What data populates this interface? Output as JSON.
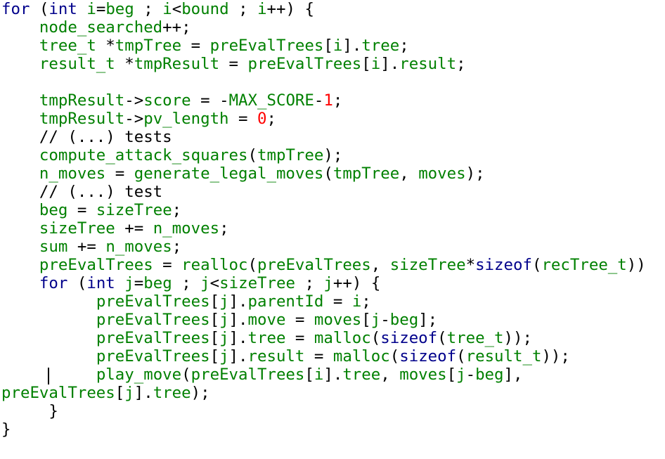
{
  "editor": {
    "colors": {
      "keyword": "#00008b",
      "identifier": "#008000",
      "number": "#ff0000",
      "punctuation": "#000000",
      "background": "#ffffff"
    },
    "lines": [
      [
        [
          "kw",
          "for"
        ],
        [
          "sp",
          " "
        ],
        [
          "pun",
          "("
        ],
        [
          "kw",
          "int"
        ],
        [
          "sp",
          " "
        ],
        [
          "id",
          "i"
        ],
        [
          "pun",
          "="
        ],
        [
          "id",
          "beg"
        ],
        [
          "sp",
          " "
        ],
        [
          "pun",
          ";"
        ],
        [
          "sp",
          " "
        ],
        [
          "id",
          "i"
        ],
        [
          "pun",
          "<"
        ],
        [
          "id",
          "bound"
        ],
        [
          "sp",
          " "
        ],
        [
          "pun",
          ";"
        ],
        [
          "sp",
          " "
        ],
        [
          "id",
          "i"
        ],
        [
          "pun",
          "++) {"
        ]
      ],
      [
        [
          "sp",
          "    "
        ],
        [
          "id",
          "node_searched"
        ],
        [
          "pun",
          "++;"
        ]
      ],
      [
        [
          "sp",
          "    "
        ],
        [
          "id",
          "tree_t"
        ],
        [
          "sp",
          " "
        ],
        [
          "pun",
          "*"
        ],
        [
          "id",
          "tmpTree"
        ],
        [
          "sp",
          " "
        ],
        [
          "pun",
          "="
        ],
        [
          "sp",
          " "
        ],
        [
          "id",
          "preEvalTrees"
        ],
        [
          "pun",
          "["
        ],
        [
          "id",
          "i"
        ],
        [
          "pun",
          "]."
        ],
        [
          "id",
          "tree"
        ],
        [
          "pun",
          ";"
        ]
      ],
      [
        [
          "sp",
          "    "
        ],
        [
          "id",
          "result_t"
        ],
        [
          "sp",
          " "
        ],
        [
          "pun",
          "*"
        ],
        [
          "id",
          "tmpResult"
        ],
        [
          "sp",
          " "
        ],
        [
          "pun",
          "="
        ],
        [
          "sp",
          " "
        ],
        [
          "id",
          "preEvalTrees"
        ],
        [
          "pun",
          "["
        ],
        [
          "id",
          "i"
        ],
        [
          "pun",
          "]."
        ],
        [
          "id",
          "result"
        ],
        [
          "pun",
          ";"
        ]
      ],
      [],
      [
        [
          "sp",
          "    "
        ],
        [
          "id",
          "tmpResult"
        ],
        [
          "pun",
          "->"
        ],
        [
          "id",
          "score"
        ],
        [
          "sp",
          " "
        ],
        [
          "pun",
          "="
        ],
        [
          "sp",
          " "
        ],
        [
          "pun",
          "-"
        ],
        [
          "id",
          "MAX_SCORE"
        ],
        [
          "pun",
          "-"
        ],
        [
          "num",
          "1"
        ],
        [
          "pun",
          ";"
        ]
      ],
      [
        [
          "sp",
          "    "
        ],
        [
          "id",
          "tmpResult"
        ],
        [
          "pun",
          "->"
        ],
        [
          "id",
          "pv_length"
        ],
        [
          "sp",
          " "
        ],
        [
          "pun",
          "="
        ],
        [
          "sp",
          " "
        ],
        [
          "num",
          "0"
        ],
        [
          "pun",
          ";"
        ]
      ],
      [
        [
          "sp",
          "    "
        ],
        [
          "cmt",
          "// (...) tests"
        ]
      ],
      [
        [
          "sp",
          "    "
        ],
        [
          "id",
          "compute_attack_squares"
        ],
        [
          "pun",
          "("
        ],
        [
          "id",
          "tmpTree"
        ],
        [
          "pun",
          ");"
        ]
      ],
      [
        [
          "sp",
          "    "
        ],
        [
          "id",
          "n_moves"
        ],
        [
          "sp",
          " "
        ],
        [
          "pun",
          "="
        ],
        [
          "sp",
          " "
        ],
        [
          "id",
          "generate_legal_moves"
        ],
        [
          "pun",
          "("
        ],
        [
          "id",
          "tmpTree"
        ],
        [
          "pun",
          ","
        ],
        [
          "sp",
          " "
        ],
        [
          "id",
          "moves"
        ],
        [
          "pun",
          ");"
        ]
      ],
      [
        [
          "sp",
          "    "
        ],
        [
          "cmt",
          "// (...) test"
        ]
      ],
      [
        [
          "sp",
          "    "
        ],
        [
          "id",
          "beg"
        ],
        [
          "sp",
          " "
        ],
        [
          "pun",
          "="
        ],
        [
          "sp",
          " "
        ],
        [
          "id",
          "sizeTree"
        ],
        [
          "pun",
          ";"
        ]
      ],
      [
        [
          "sp",
          "    "
        ],
        [
          "id",
          "sizeTree"
        ],
        [
          "sp",
          " "
        ],
        [
          "pun",
          "+="
        ],
        [
          "sp",
          " "
        ],
        [
          "id",
          "n_moves"
        ],
        [
          "pun",
          ";"
        ]
      ],
      [
        [
          "sp",
          "    "
        ],
        [
          "id",
          "sum"
        ],
        [
          "sp",
          " "
        ],
        [
          "pun",
          "+="
        ],
        [
          "sp",
          " "
        ],
        [
          "id",
          "n_moves"
        ],
        [
          "pun",
          ";"
        ]
      ],
      [
        [
          "sp",
          "    "
        ],
        [
          "id",
          "preEvalTrees"
        ],
        [
          "sp",
          " "
        ],
        [
          "pun",
          "="
        ],
        [
          "sp",
          " "
        ],
        [
          "id",
          "realloc"
        ],
        [
          "pun",
          "("
        ],
        [
          "id",
          "preEvalTrees"
        ],
        [
          "pun",
          ","
        ],
        [
          "sp",
          " "
        ],
        [
          "id",
          "sizeTree"
        ],
        [
          "pun",
          "*"
        ],
        [
          "kw",
          "sizeof"
        ],
        [
          "pun",
          "("
        ],
        [
          "id",
          "recTree_t"
        ],
        [
          "pun",
          "))"
        ]
      ],
      [
        [
          "sp",
          "    "
        ],
        [
          "kw",
          "for"
        ],
        [
          "sp",
          " "
        ],
        [
          "pun",
          "("
        ],
        [
          "kw",
          "int"
        ],
        [
          "sp",
          " "
        ],
        [
          "id",
          "j"
        ],
        [
          "pun",
          "="
        ],
        [
          "id",
          "beg"
        ],
        [
          "sp",
          " "
        ],
        [
          "pun",
          ";"
        ],
        [
          "sp",
          " "
        ],
        [
          "id",
          "j"
        ],
        [
          "pun",
          "<"
        ],
        [
          "id",
          "sizeTree"
        ],
        [
          "sp",
          " "
        ],
        [
          "pun",
          ";"
        ],
        [
          "sp",
          " "
        ],
        [
          "id",
          "j"
        ],
        [
          "pun",
          "++) {"
        ]
      ],
      [
        [
          "sp",
          "          "
        ],
        [
          "id",
          "preEvalTrees"
        ],
        [
          "pun",
          "["
        ],
        [
          "id",
          "j"
        ],
        [
          "pun",
          "]."
        ],
        [
          "id",
          "parentId"
        ],
        [
          "sp",
          " "
        ],
        [
          "pun",
          "="
        ],
        [
          "sp",
          " "
        ],
        [
          "id",
          "i"
        ],
        [
          "pun",
          ";"
        ]
      ],
      [
        [
          "sp",
          "          "
        ],
        [
          "id",
          "preEvalTrees"
        ],
        [
          "pun",
          "["
        ],
        [
          "id",
          "j"
        ],
        [
          "pun",
          "]."
        ],
        [
          "id",
          "move"
        ],
        [
          "sp",
          " "
        ],
        [
          "pun",
          "="
        ],
        [
          "sp",
          " "
        ],
        [
          "id",
          "moves"
        ],
        [
          "pun",
          "["
        ],
        [
          "id",
          "j"
        ],
        [
          "pun",
          "-"
        ],
        [
          "id",
          "beg"
        ],
        [
          "pun",
          "];"
        ]
      ],
      [
        [
          "sp",
          "          "
        ],
        [
          "id",
          "preEvalTrees"
        ],
        [
          "pun",
          "["
        ],
        [
          "id",
          "j"
        ],
        [
          "pun",
          "]."
        ],
        [
          "id",
          "tree"
        ],
        [
          "sp",
          " "
        ],
        [
          "pun",
          "="
        ],
        [
          "sp",
          " "
        ],
        [
          "id",
          "malloc"
        ],
        [
          "pun",
          "("
        ],
        [
          "kw",
          "sizeof"
        ],
        [
          "pun",
          "("
        ],
        [
          "id",
          "tree_t"
        ],
        [
          "pun",
          "));"
        ]
      ],
      [
        [
          "sp",
          "          "
        ],
        [
          "id",
          "preEvalTrees"
        ],
        [
          "pun",
          "["
        ],
        [
          "id",
          "j"
        ],
        [
          "pun",
          "]."
        ],
        [
          "id",
          "result"
        ],
        [
          "sp",
          " "
        ],
        [
          "pun",
          "="
        ],
        [
          "sp",
          " "
        ],
        [
          "id",
          "malloc"
        ],
        [
          "pun",
          "("
        ],
        [
          "kw",
          "sizeof"
        ],
        [
          "pun",
          "("
        ],
        [
          "id",
          "result_t"
        ],
        [
          "pun",
          "));"
        ]
      ],
      [
        [
          "sp",
          "          "
        ],
        [
          "id",
          "play_move"
        ],
        [
          "pun",
          "("
        ],
        [
          "id",
          "preEvalTrees"
        ],
        [
          "pun",
          "["
        ],
        [
          "id",
          "i"
        ],
        [
          "pun",
          "]."
        ],
        [
          "id",
          "tree"
        ],
        [
          "pun",
          ","
        ],
        [
          "sp",
          " "
        ],
        [
          "id",
          "moves"
        ],
        [
          "pun",
          "["
        ],
        [
          "id",
          "j"
        ],
        [
          "pun",
          "-"
        ],
        [
          "id",
          "beg"
        ],
        [
          "pun",
          "],"
        ]
      ],
      [
        [
          "id",
          "preEvalTrees"
        ],
        [
          "pun",
          "["
        ],
        [
          "id",
          "j"
        ],
        [
          "pun",
          "]."
        ],
        [
          "id",
          "tree"
        ],
        [
          "pun",
          ");"
        ]
      ],
      [
        [
          "sp",
          "     "
        ],
        [
          "pun",
          "}"
        ]
      ],
      [
        [
          "pun",
          "}"
        ]
      ]
    ]
  }
}
